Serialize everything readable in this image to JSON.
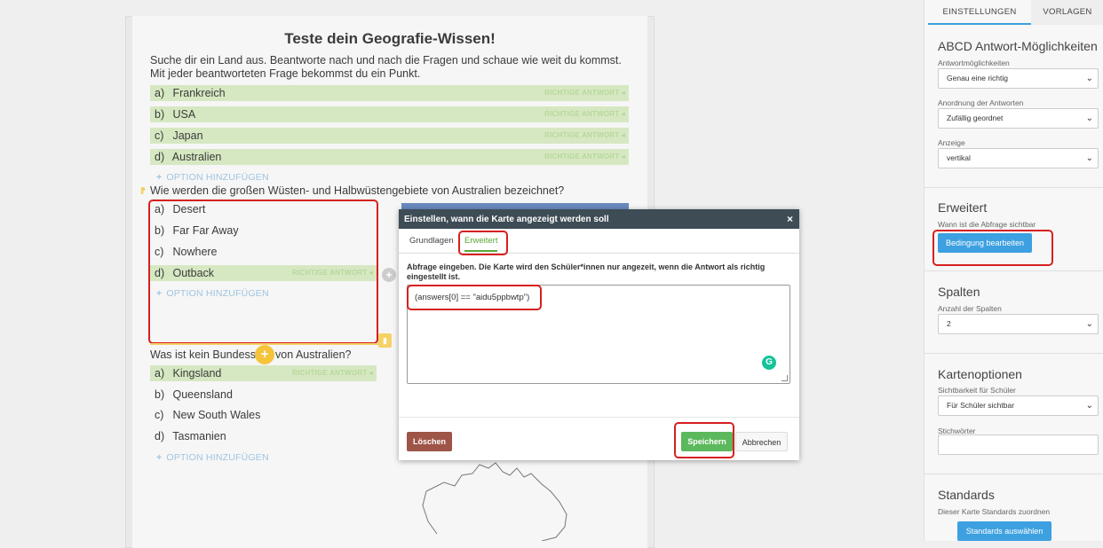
{
  "card": {
    "title": "Teste dein Geografie-Wissen!",
    "intro": "Suche dir ein Land aus. Beantworte nach und nach die Fragen und schaue wie weit du kommst. Mit jeder beantworteten Frage bekommst du ein Punkt.",
    "correct_label": "RICHTIGE ANTWORT",
    "add_option": "OPTION HINZUFÜGEN",
    "q1": {
      "options": [
        {
          "letter": "a)",
          "text": "Frankreich",
          "correct": true
        },
        {
          "letter": "b)",
          "text": "USA",
          "correct": true
        },
        {
          "letter": "c)",
          "text": "Japan",
          "correct": true
        },
        {
          "letter": "d)",
          "text": "Australien",
          "correct": true
        }
      ]
    },
    "q2": {
      "question": "Wie werden die großen Wüsten- und Halbwüstengebiete von Australien bezeichnet?",
      "options": [
        {
          "letter": "a)",
          "text": "Desert",
          "correct": false
        },
        {
          "letter": "b)",
          "text": "Far Far Away",
          "correct": false
        },
        {
          "letter": "c)",
          "text": "Nowhere",
          "correct": false
        },
        {
          "letter": "d)",
          "text": "Outback",
          "correct": true
        }
      ]
    },
    "q3": {
      "question_start": "Was ist kein Bundess",
      "question_end": "von Australien?",
      "options": [
        {
          "letter": "a)",
          "text": "Kingsland",
          "correct": true
        },
        {
          "letter": "b)",
          "text": "Queensland",
          "correct": false
        },
        {
          "letter": "c)",
          "text": "New South Wales",
          "correct": false
        },
        {
          "letter": "d)",
          "text": "Tasmanien",
          "correct": false
        }
      ]
    }
  },
  "dialog": {
    "title": "Einstellen, wann die Karte angezeigt werden soll",
    "close": "×",
    "tabs": [
      "Grundlagen",
      "Erweitert"
    ],
    "active_tab": "Erweitert",
    "instruction": "Abfrage eingeben. Die Karte wird den Schüler*innen nur angezeit, wenn die Antwort als richtig eingestellt ist.",
    "query": "(answers[0] == \"aidu5ppbwtp\")",
    "delete_label": "Löschen",
    "save_label": "Speichern",
    "cancel_label": "Abbrechen"
  },
  "sidebar": {
    "tabs": [
      "EINSTELLUNGEN",
      "VORLAGEN"
    ],
    "active_tab": "EINSTELLUNGEN",
    "abcd": {
      "title": "ABCD Antwort-Möglichkeiten",
      "answer_options_label": "Antwortmöglichkeiten",
      "answer_options_value": "Genau eine richtig",
      "order_label": "Anordnung der Antworten",
      "order_value": "Zufällig geordnet",
      "display_label": "Anzeige",
      "display_value": "vertikal"
    },
    "advanced": {
      "title": "Erweitert",
      "visible_label": "Wann ist die Abfrage sichtbar",
      "edit_condition": "Bedingung bearbeiten"
    },
    "columns": {
      "title": "Spalten",
      "count_label": "Anzahl der Spalten",
      "count_value": "2"
    },
    "card_options": {
      "title": "Kartenoptionen",
      "visibility_label": "Sichtbarkeit für Schüler",
      "visibility_value": "Für Schüler sichtbar",
      "keywords_label": "Stichwörter"
    },
    "standards": {
      "title": "Standards",
      "assign_label": "Dieser Karte Standards zuordnen",
      "select_button": "Standards auswählen"
    }
  },
  "colors": {
    "correct_bg": "#d6e8c2",
    "highlight_red": "#d62020",
    "save_green": "#5cb85c",
    "delete_brown": "#9e5447",
    "accent_blue": "#3da0e0",
    "dialog_header": "#3d4c55"
  }
}
